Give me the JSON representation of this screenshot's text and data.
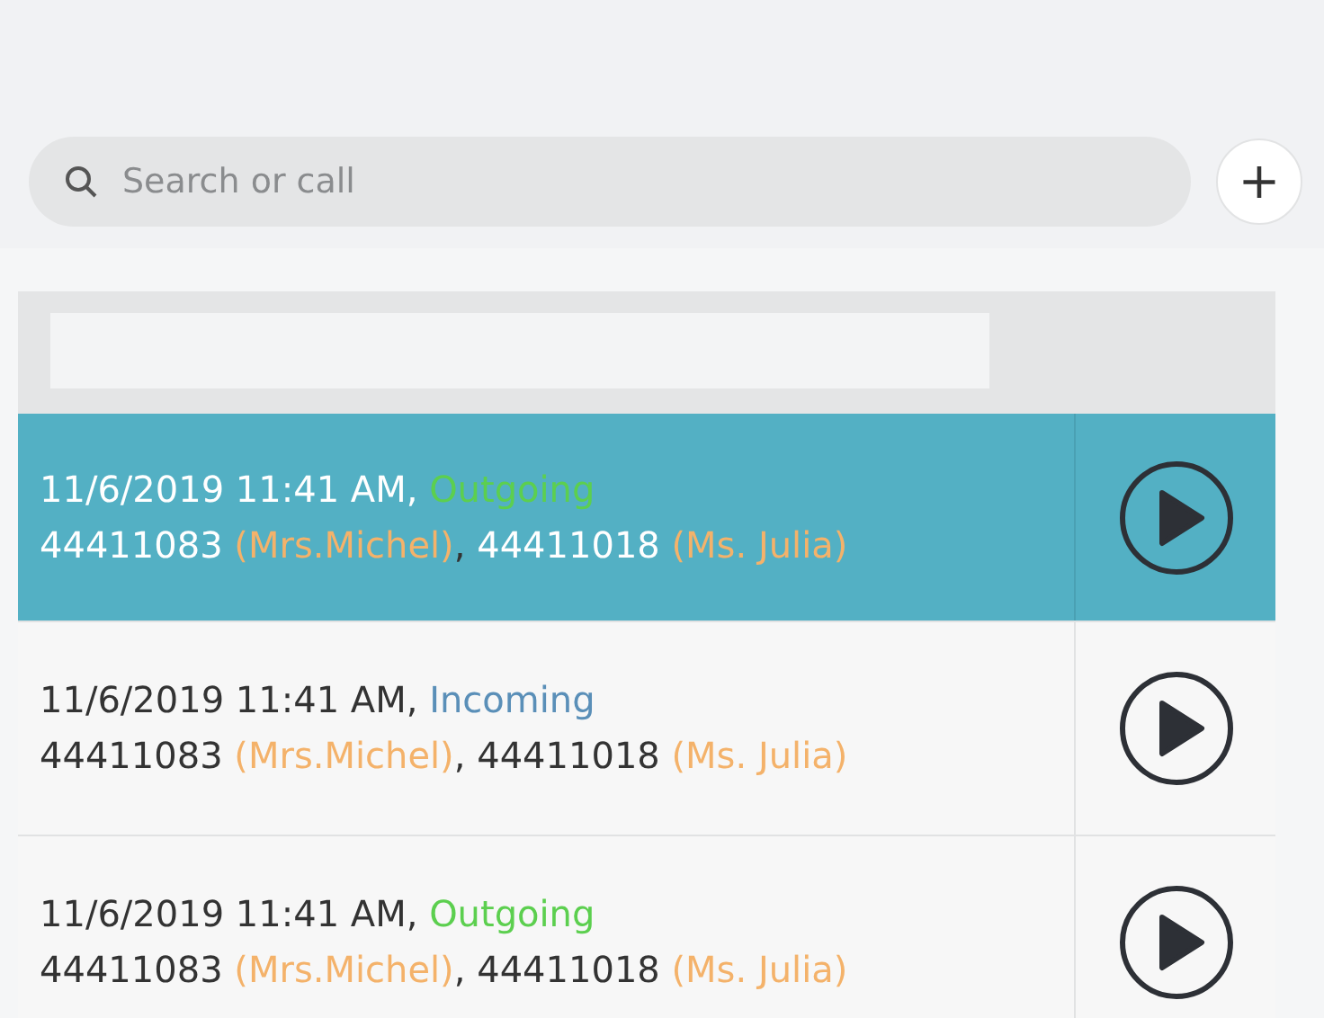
{
  "search": {
    "placeholder": "Search or call"
  },
  "add_button": {
    "label": "+"
  },
  "calls": [
    {
      "selected": true,
      "time": "11/6/2019 11:41 AM,",
      "direction": {
        "label": "Outgoing",
        "kind": "outgoing"
      },
      "parties": [
        {
          "number": "44411083",
          "name": "(Mrs.Michel)"
        },
        {
          "number": "44411018",
          "name": "(Ms. Julia)"
        }
      ],
      "separator": ","
    },
    {
      "selected": false,
      "time": "11/6/2019 11:41 AM,",
      "direction": {
        "label": "Incoming",
        "kind": "incoming"
      },
      "parties": [
        {
          "number": "44411083",
          "name": "(Mrs.Michel)"
        },
        {
          "number": "44411018",
          "name": "(Ms. Julia)"
        }
      ],
      "separator": ","
    },
    {
      "selected": false,
      "time": "11/6/2019 11:41 AM,",
      "direction": {
        "label": "Outgoing",
        "kind": "outgoing"
      },
      "parties": [
        {
          "number": "44411083",
          "name": "(Mrs.Michel)"
        },
        {
          "number": "44411018",
          "name": "(Ms. Julia)"
        }
      ],
      "separator": ","
    }
  ]
}
